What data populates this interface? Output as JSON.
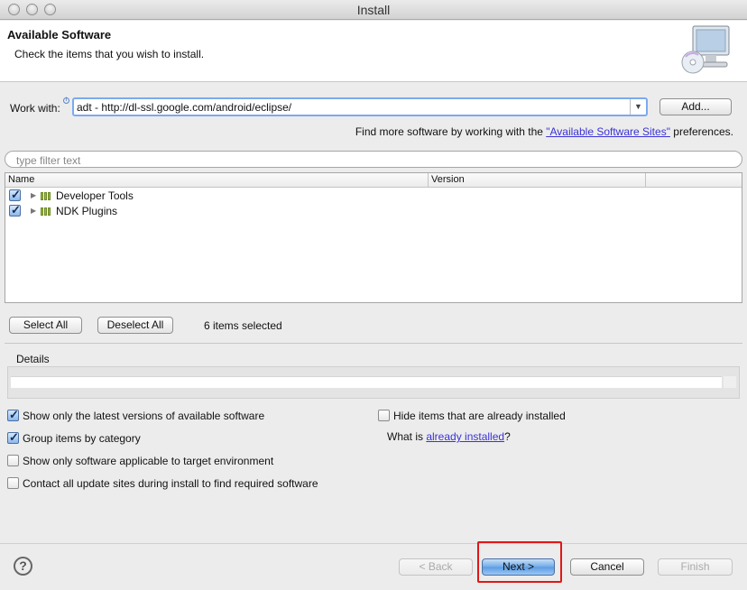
{
  "window": {
    "title": "Install"
  },
  "header": {
    "title": "Available Software",
    "subtitle": "Check the items that you wish to install.",
    "icon": "computer-cd-icon"
  },
  "work_with": {
    "label": "Work with:",
    "value": "adt - http://dl-ssl.google.com/android/eclipse/",
    "add_label": "Add..."
  },
  "find_more": {
    "prefix": "Find more software by working with the ",
    "link": "\"Available Software Sites\"",
    "suffix": " preferences."
  },
  "filter": {
    "placeholder": "type filter text"
  },
  "tree": {
    "columns": [
      "Name",
      "Version"
    ],
    "items": [
      {
        "label": "Developer Tools",
        "checked": true
      },
      {
        "label": "NDK Plugins",
        "checked": true
      }
    ]
  },
  "selection": {
    "select_all": "Select All",
    "deselect_all": "Deselect All",
    "count_text": "6 items selected"
  },
  "details": {
    "label": "Details"
  },
  "options": {
    "latest_versions": {
      "label": "Show only the latest versions of available software",
      "checked": true
    },
    "group_by_category": {
      "label": "Group items by category",
      "checked": true
    },
    "target_env": {
      "label": "Show only software applicable to target environment",
      "checked": false
    },
    "contact_sites": {
      "label": "Contact all update sites during install to find required software",
      "checked": false
    },
    "hide_installed": {
      "label": "Hide items that are already installed",
      "checked": false
    },
    "what_is": {
      "prefix": "What is ",
      "link": "already installed",
      "suffix": "?"
    }
  },
  "footer": {
    "help_icon": "help-icon",
    "back": "< Back",
    "next": "Next >",
    "cancel": "Cancel",
    "finish": "Finish"
  },
  "colors": {
    "highlight": "#e11717",
    "link": "#3a32d6",
    "accent": "#5b9be2"
  }
}
